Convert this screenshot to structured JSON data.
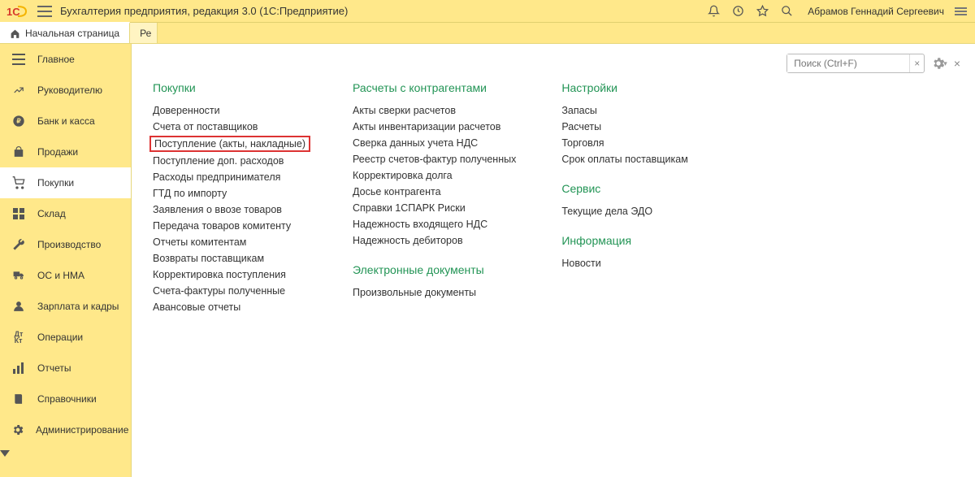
{
  "header": {
    "title": "Бухгалтерия предприятия, редакция 3.0   (1С:Предприятие)",
    "user": "Абрамов Геннадий Сергеевич"
  },
  "tabs": [
    {
      "label": "Начальная страница",
      "active": true
    },
    {
      "label": "Ре",
      "active": false
    }
  ],
  "search": {
    "placeholder": "Поиск (Ctrl+F)"
  },
  "sidebar": [
    {
      "label": "Главное",
      "icon": "menu"
    },
    {
      "label": "Руководителю",
      "icon": "chart"
    },
    {
      "label": "Банк и касса",
      "icon": "ruble"
    },
    {
      "label": "Продажи",
      "icon": "bag"
    },
    {
      "label": "Покупки",
      "icon": "cart",
      "active": true
    },
    {
      "label": "Склад",
      "icon": "grid"
    },
    {
      "label": "Производство",
      "icon": "wrench"
    },
    {
      "label": "ОС и НМА",
      "icon": "truck"
    },
    {
      "label": "Зарплата и кадры",
      "icon": "person"
    },
    {
      "label": "Операции",
      "icon": "dtkt"
    },
    {
      "label": "Отчеты",
      "icon": "bars"
    },
    {
      "label": "Справочники",
      "icon": "book"
    },
    {
      "label": "Администрирование",
      "icon": "gear"
    }
  ],
  "sections": {
    "purchases": {
      "title": "Покупки",
      "items": [
        "Доверенности",
        "Счета от поставщиков",
        "Поступление (акты, накладные)",
        "Поступление доп. расходов",
        "Расходы предпринимателя",
        "ГТД по импорту",
        "Заявления о ввозе товаров",
        "Передача товаров комитенту",
        "Отчеты комитентам",
        "Возвраты поставщикам",
        "Корректировка поступления",
        "Счета-фактуры полученные",
        "Авансовые отчеты"
      ],
      "highlight_index": 2
    },
    "settlements": {
      "title": "Расчеты с контрагентами",
      "items": [
        "Акты сверки расчетов",
        "Акты инвентаризации расчетов",
        "Сверка данных учета НДС",
        "Реестр счетов-фактур полученных",
        "Корректировка долга",
        "Досье контрагента",
        "Справки 1СПАРК Риски",
        "Надежность входящего НДС",
        "Надежность дебиторов"
      ]
    },
    "edocs": {
      "title": "Электронные документы",
      "items": [
        "Произвольные документы"
      ]
    },
    "settings": {
      "title": "Настройки",
      "items": [
        "Запасы",
        "Расчеты",
        "Торговля",
        "Срок оплаты поставщикам"
      ]
    },
    "service": {
      "title": "Сервис",
      "items": [
        "Текущие дела ЭДО"
      ]
    },
    "info": {
      "title": "Информация",
      "items": [
        "Новости"
      ]
    }
  }
}
